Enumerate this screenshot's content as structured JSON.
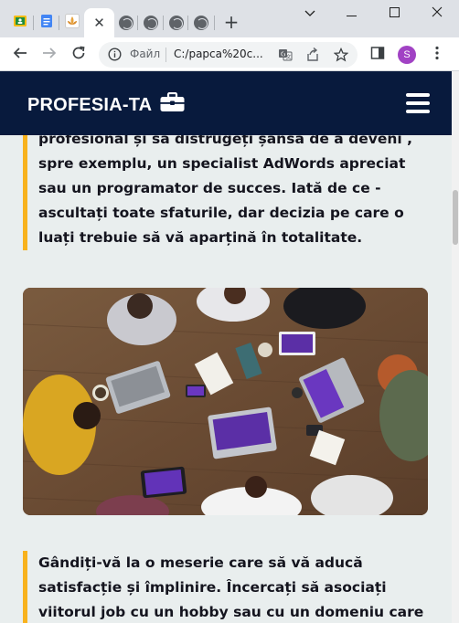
{
  "browser": {
    "tabs": [
      {
        "icon": "google-classroom-icon"
      },
      {
        "icon": "google-docs-icon"
      },
      {
        "icon": "lotus-icon"
      },
      {
        "icon": "close-icon",
        "active": true
      },
      {
        "icon": "globe-icon"
      },
      {
        "icon": "globe-icon"
      },
      {
        "icon": "globe-icon"
      },
      {
        "icon": "globe-icon"
      }
    ],
    "new_tab_label": "+",
    "address": {
      "scheme_label": "Файл",
      "url": "C:/papca%20c..."
    },
    "profile_initial": "S"
  },
  "site": {
    "logo_text": "PROFESIA-TA",
    "logo_icon": "briefcase-icon",
    "menu_icon": "hamburger-menu-icon"
  },
  "content": {
    "quote1_text": "profesional și să distrugeți șansa de a deveni , spre exemplu, un specialist AdWords apreciat sau un programator de succes. Iată de ce - ascultați toate sfaturile, dar decizia pe care o luați trebuie să vă aparțină în totalitate.",
    "image_description": "team-meeting-photo",
    "quote2_text": "Gândiți-vă la o meserie care să vă aducă satisfacție și împlinire. Încercați să asociați viitorul job cu un hobby sau cu un domeniu care este foarte apropiat"
  },
  "colors": {
    "header_bg": "#081a3d",
    "accent_border": "#f8b21d",
    "page_bg": "#e9eeee"
  }
}
